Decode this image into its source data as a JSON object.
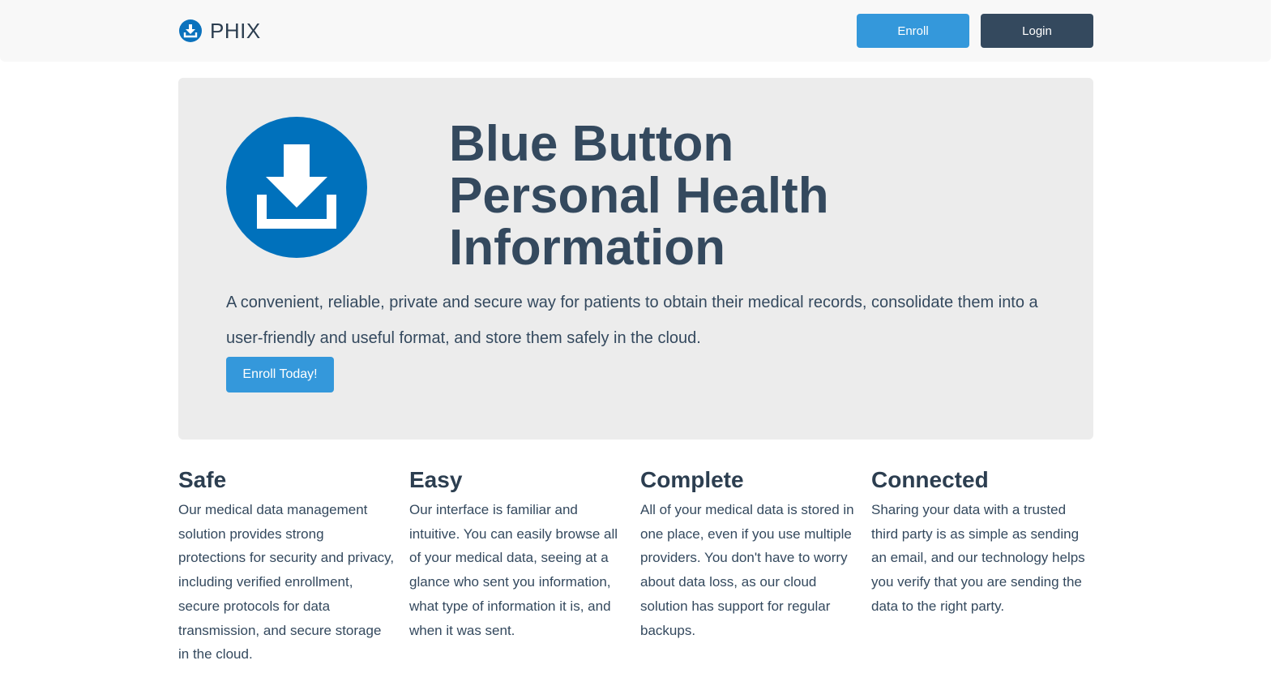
{
  "navbar": {
    "brand_icon": "download-circle-icon",
    "brand_name": "PHIX",
    "enroll_label": "Enroll",
    "login_label": "Login"
  },
  "hero": {
    "icon": "download-icon",
    "title_lines": [
      "Blue Button",
      "Personal Health",
      "Information"
    ],
    "description": "A convenient, reliable, private and secure way for patients to obtain their medical records, consolidate them into a user-friendly and useful format, and store them safely in the cloud.",
    "cta_label": "Enroll Today!"
  },
  "features": [
    {
      "title": "Safe",
      "text": "Our medical data management solution provides strong protections for security and privacy, including verified enrollment, secure protocols for data transmission, and secure storage in the cloud."
    },
    {
      "title": "Easy",
      "text": "Our interface is familiar and intuitive. You can easily browse all of your medical data, seeing at a glance who sent you information, what type of information it is, and when it was sent."
    },
    {
      "title": "Complete",
      "text": "All of your medical data is stored in one place, even if you use multiple providers. You don't have to worry about data loss, as our cloud solution has support for regular backups."
    },
    {
      "title": "Connected",
      "text": "Sharing your data with a trusted third party is as simple as sending an email, and our technology helps you verify that you are sending the data to the right party."
    }
  ],
  "colors": {
    "primary": "#3498db",
    "dark": "#34495e",
    "logo_blue": "#0071bc",
    "jumbotron_bg": "#ececec",
    "navbar_bg": "#f8f8f8"
  }
}
